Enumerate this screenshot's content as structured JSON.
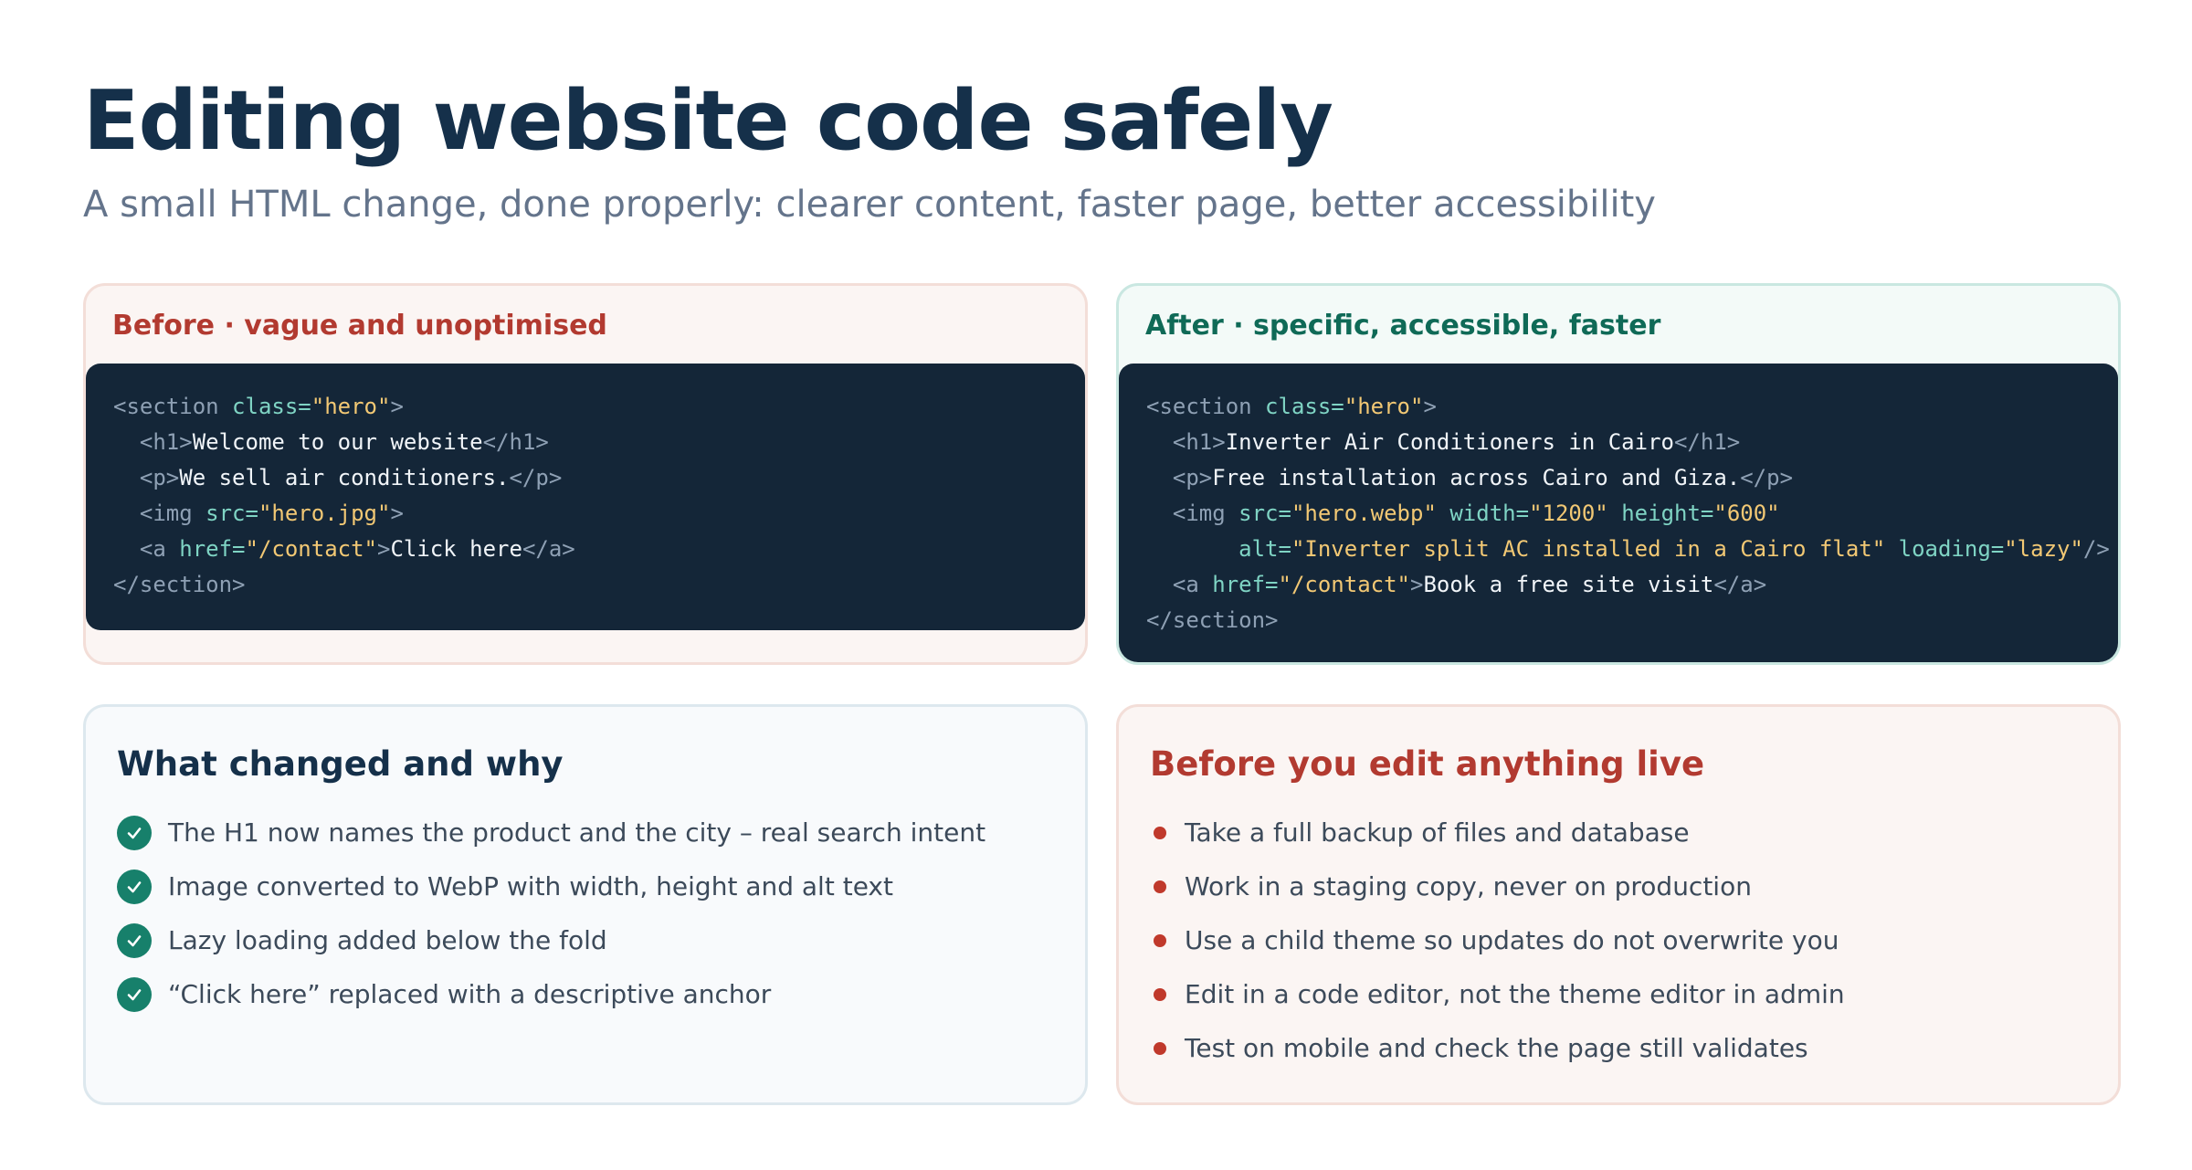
{
  "header": {
    "title": "Editing website code safely",
    "subtitle": "A small HTML change, done properly: clearer content, faster page, better accessibility"
  },
  "before_card": {
    "label": "Before · vague and unoptimised",
    "code_lines": [
      [
        [
          "tag",
          "<section "
        ],
        [
          "attr",
          "class="
        ],
        [
          "str",
          "\"hero\""
        ],
        [
          "tag",
          ">"
        ]
      ],
      [
        [
          "tag",
          "  <h1>"
        ],
        [
          "text",
          "Welcome to our website"
        ],
        [
          "tag",
          "</h1>"
        ]
      ],
      [
        [
          "tag",
          "  <p>"
        ],
        [
          "text",
          "We sell air conditioners."
        ],
        [
          "tag",
          "</p>"
        ]
      ],
      [
        [
          "tag",
          "  <img "
        ],
        [
          "attr",
          "src="
        ],
        [
          "str",
          "\"hero.jpg\""
        ],
        [
          "tag",
          ">"
        ]
      ],
      [
        [
          "tag",
          "  <a "
        ],
        [
          "attr",
          "href="
        ],
        [
          "str",
          "\"/contact\""
        ],
        [
          "tag",
          ">"
        ],
        [
          "text",
          "Click here"
        ],
        [
          "tag",
          "</a>"
        ]
      ],
      [
        [
          "tag",
          "</section>"
        ]
      ]
    ]
  },
  "after_card": {
    "label": "After · specific, accessible, faster",
    "code_lines": [
      [
        [
          "tag",
          "<section "
        ],
        [
          "attr",
          "class="
        ],
        [
          "str",
          "\"hero\""
        ],
        [
          "tag",
          ">"
        ]
      ],
      [
        [
          "tag",
          "  <h1>"
        ],
        [
          "text",
          "Inverter Air Conditioners in Cairo"
        ],
        [
          "tag",
          "</h1>"
        ]
      ],
      [
        [
          "tag",
          "  <p>"
        ],
        [
          "text",
          "Free installation across Cairo and Giza."
        ],
        [
          "tag",
          "</p>"
        ]
      ],
      [
        [
          "tag",
          "  <img "
        ],
        [
          "attr",
          "src="
        ],
        [
          "str",
          "\"hero.webp\""
        ],
        [
          "tag",
          " "
        ],
        [
          "attr",
          "width="
        ],
        [
          "str",
          "\"1200\""
        ],
        [
          "tag",
          " "
        ],
        [
          "attr",
          "height="
        ],
        [
          "str",
          "\"600\""
        ]
      ],
      [
        [
          "tag",
          "       "
        ],
        [
          "attr",
          "alt="
        ],
        [
          "str",
          "\"Inverter split AC installed in a Cairo flat\""
        ],
        [
          "tag",
          " "
        ],
        [
          "attr",
          "loading="
        ],
        [
          "str",
          "\"lazy\""
        ],
        [
          "tag",
          "/>"
        ]
      ],
      [
        [
          "tag",
          "  <a "
        ],
        [
          "attr",
          "href="
        ],
        [
          "str",
          "\"/contact\""
        ],
        [
          "tag",
          ">"
        ],
        [
          "text",
          "Book a free site visit"
        ],
        [
          "tag",
          "</a>"
        ]
      ],
      [
        [
          "tag",
          "</section>"
        ]
      ]
    ]
  },
  "changes": {
    "title": "What changed and why",
    "icon": "check-circle-icon",
    "items": [
      "The H1 now names the product and the city – real search intent",
      "Image converted to WebP with width, height and alt text",
      "Lazy loading added below the fold",
      "“Click here” replaced with a descriptive anchor"
    ]
  },
  "checklist": {
    "title": "Before you edit anything live",
    "icon": "bullet-dot-icon",
    "items": [
      "Take a full backup of files and database",
      "Work in a staging copy, never on production",
      "Use a child theme so updates do not overwrite you",
      "Edit in a code editor, not the theme editor in admin",
      "Test on mobile and check the page still validates"
    ]
  },
  "colors": {
    "title": "#15304a",
    "before_accent": "#b23a30",
    "after_accent": "#0f6a57",
    "code_bg": "#142638",
    "check": "#17806b",
    "bullet": "#c0392b"
  }
}
